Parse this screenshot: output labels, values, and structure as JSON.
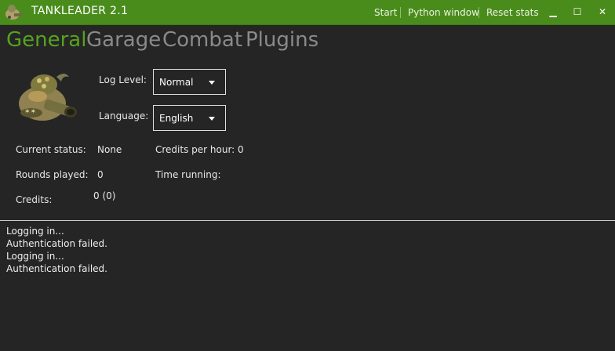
{
  "titlebar": {
    "title": "TANKLEADER 2.1",
    "links": {
      "start": "Start",
      "python_window": "Python window",
      "reset_stats": "Reset stats"
    },
    "minimize_symbol": "▁",
    "maximize_symbol": "☐",
    "close_symbol": "✕",
    "color": "#4a8c1c"
  },
  "tabs": {
    "general": "General",
    "garage": "Garage",
    "combat": "Combat",
    "plugins": "Plugins",
    "active_color": "#57a21f"
  },
  "settings": {
    "log_level_label": "Log Level:",
    "log_level_value": "Normal",
    "language_label": "Language:",
    "language_value": "English"
  },
  "stats": {
    "current_status_label": "Current status:",
    "current_status_value": "None",
    "credits_per_hour_label": "Credits per hour:",
    "credits_per_hour_value": "0",
    "rounds_played_label": "Rounds played:",
    "rounds_played_value": "0",
    "time_running_label": "Time running:",
    "time_running_value": "",
    "credits_label": "Credits:",
    "credits_value": "0 (0)"
  },
  "log": [
    "Logging in...",
    "Authentication failed.",
    "Logging in...",
    "Authentication failed."
  ],
  "icons": {
    "app": "tank-icon",
    "mascot": "tank-mascot-image"
  }
}
